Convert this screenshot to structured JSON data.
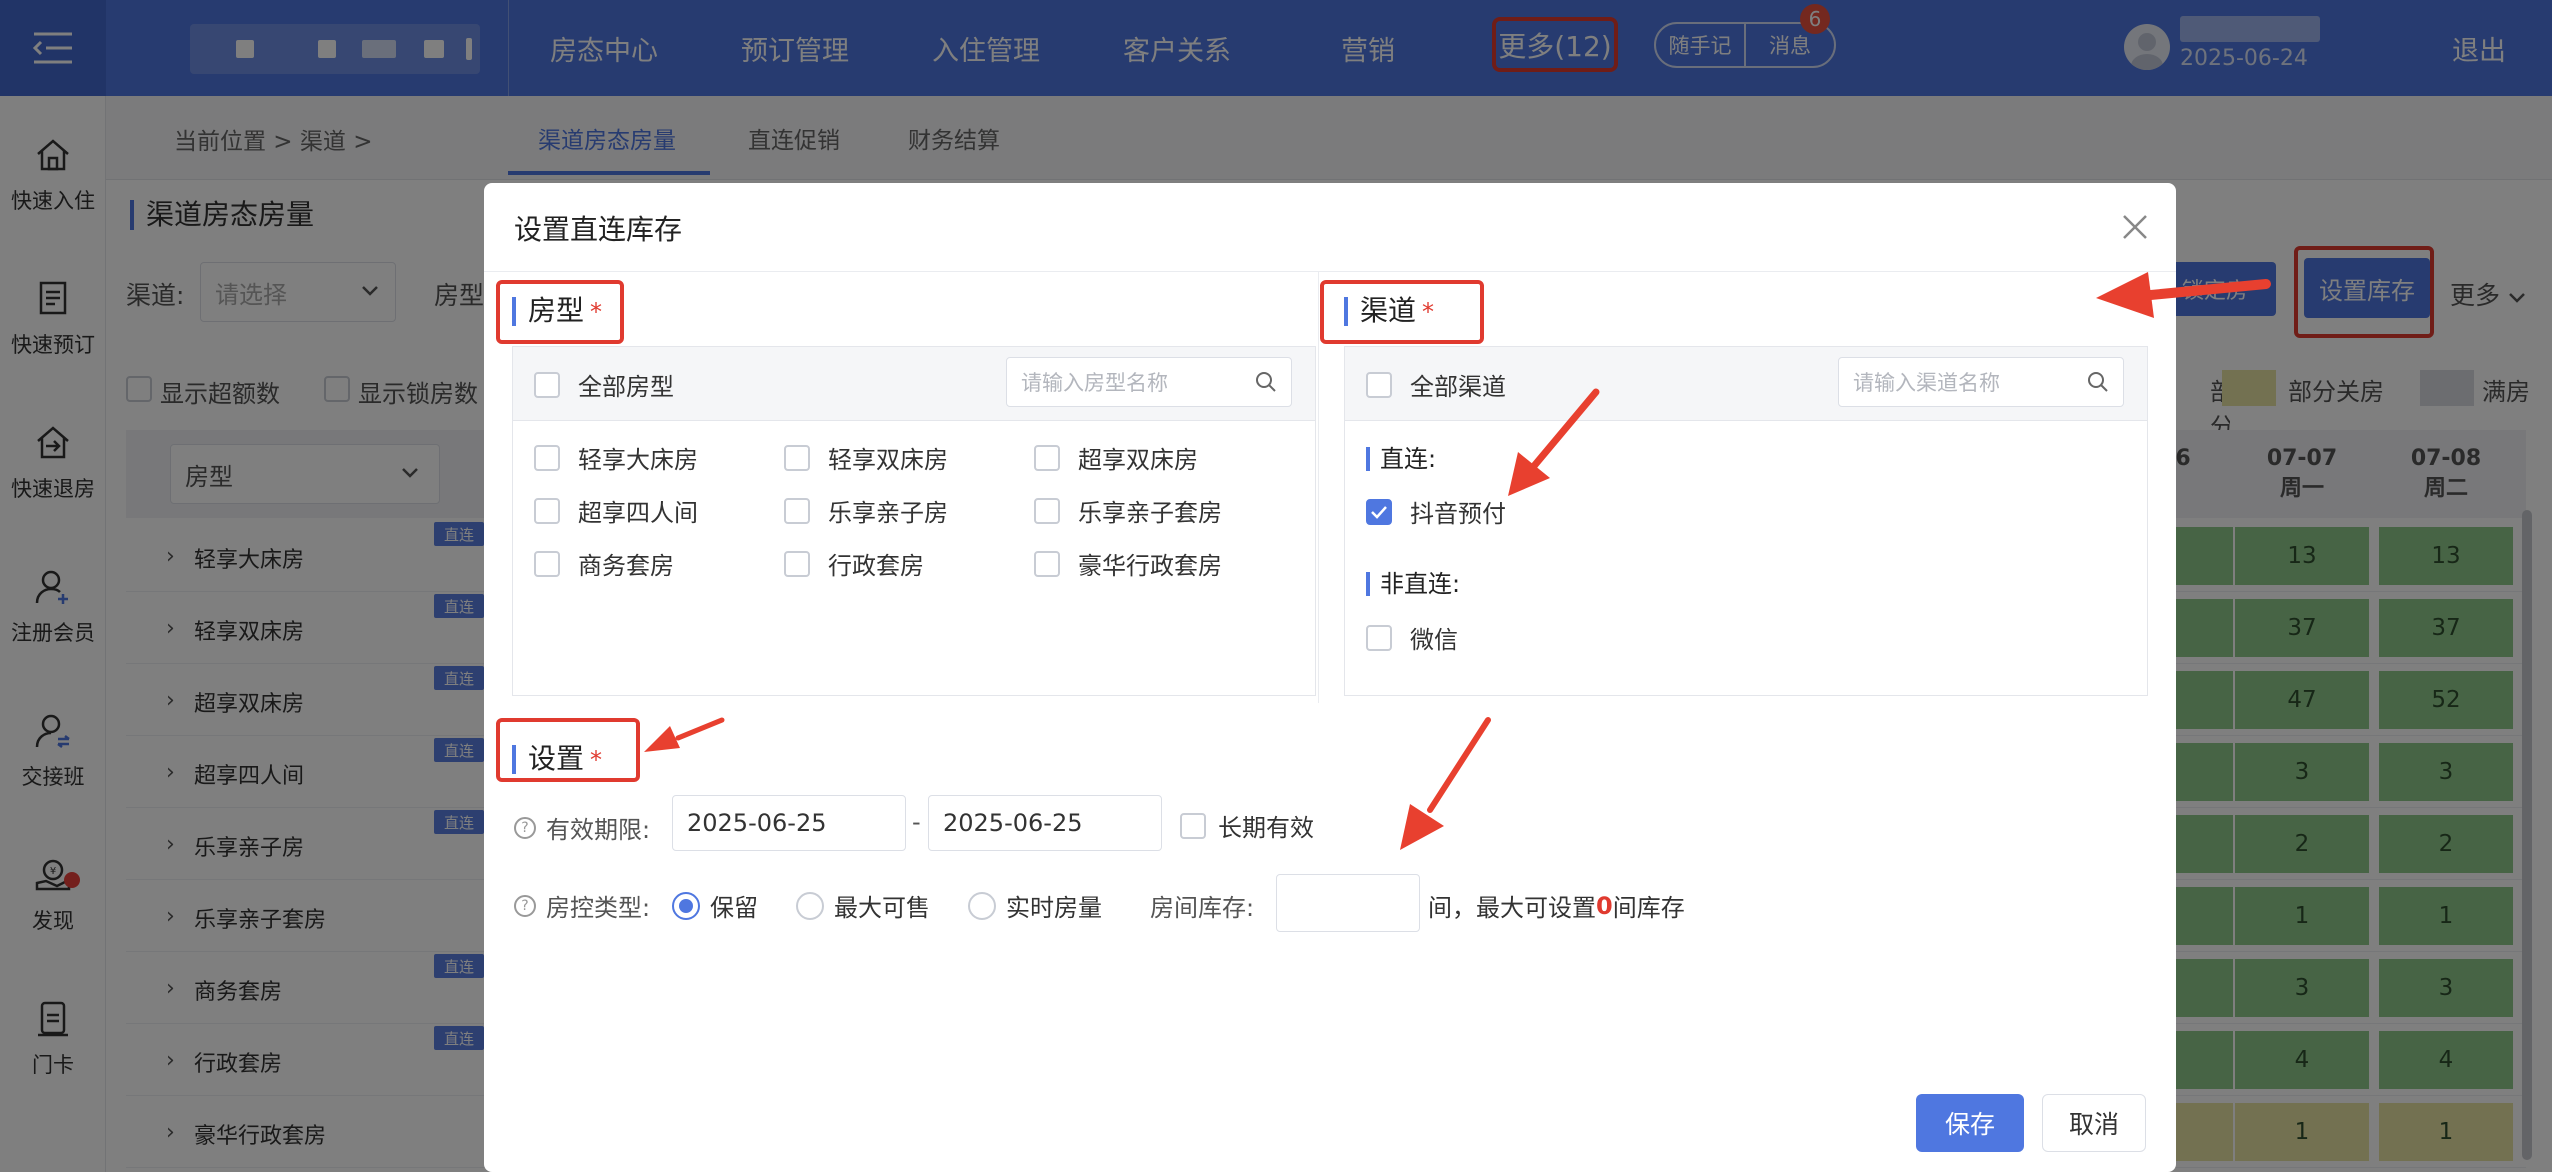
{
  "nav": {
    "items": [
      "房态中心",
      "预订管理",
      "入住管理",
      "客户关系",
      "营销"
    ],
    "more": "更多(12)",
    "notebook": "随手记",
    "messages": "消息",
    "messages_badge": "6",
    "user_date": "2025-06-24",
    "logout": "退出"
  },
  "rail": [
    {
      "label": "快速入住",
      "icon": "home-icon"
    },
    {
      "label": "快速预订",
      "icon": "document-icon"
    },
    {
      "label": "快速退房",
      "icon": "checkout-icon"
    },
    {
      "label": "注册会员",
      "icon": "add-user-icon"
    },
    {
      "label": "交接班",
      "icon": "handover-icon"
    },
    {
      "label": "发现",
      "icon": "discover-icon"
    },
    {
      "label": "门卡",
      "icon": "card-icon"
    }
  ],
  "subbar": {
    "breadcrumb": "当前位置 > 渠道 >",
    "tabs": [
      "渠道房态房量",
      "直连促销",
      "财务结算"
    ]
  },
  "page": {
    "title": "渠道房态房量",
    "channel_label": "渠道:",
    "channel_placeholder": "请选择",
    "roomtype_label": "房型",
    "show_over": "显示超额数",
    "show_lock": "显示锁房数",
    "btn_lock": "锁定房",
    "btn_set_stock": "设置库存",
    "more": "更多",
    "legend_partial": "部分关房",
    "legend_full": "满房",
    "roomtype_header": "房型",
    "col_partial": "6",
    "dates": [
      {
        "date": "07-07",
        "weekday": "周一"
      },
      {
        "date": "07-08",
        "weekday": "周二"
      }
    ],
    "direct_tag": "直连",
    "rows": [
      {
        "name": "轻享大床房",
        "direct": true,
        "v1": "13",
        "v2": "13",
        "yellow": false
      },
      {
        "name": "轻享双床房",
        "direct": true,
        "v1": "37",
        "v2": "37",
        "yellow": false
      },
      {
        "name": "超享双床房",
        "direct": true,
        "v1": "47",
        "v2": "52",
        "yellow": false
      },
      {
        "name": "超享四人间",
        "direct": true,
        "v1": "3",
        "v2": "3",
        "yellow": false
      },
      {
        "name": "乐享亲子房",
        "direct": true,
        "v1": "2",
        "v2": "2",
        "yellow": false
      },
      {
        "name": "乐享亲子套房",
        "direct": false,
        "v1": "1",
        "v2": "1",
        "yellow": false
      },
      {
        "name": "商务套房",
        "direct": true,
        "v1": "3",
        "v2": "3",
        "yellow": false
      },
      {
        "name": "行政套房",
        "direct": true,
        "v1": "4",
        "v2": "4",
        "yellow": false
      },
      {
        "name": "豪华行政套房",
        "direct": false,
        "v1": "1",
        "v2": "1",
        "yellow": true
      }
    ]
  },
  "modal": {
    "title": "设置直连库存",
    "roomtype_section": "房型",
    "required_mark": "*",
    "all_roomtypes": "全部房型",
    "roomtype_search_placeholder": "请输入房型名称",
    "roomtypes": [
      "轻享大床房",
      "轻享双床房",
      "超享双床房",
      "超享四人间",
      "乐享亲子房",
      "乐享亲子套房",
      "商务套房",
      "行政套房",
      "豪华行政套房"
    ],
    "channel_section": "渠道",
    "all_channels": "全部渠道",
    "channel_search_placeholder": "请输入渠道名称",
    "direct_group": "直连:",
    "direct_channel": "抖音预付",
    "direct_checked": true,
    "nondirect_group": "非直连:",
    "nondirect_channel": "微信",
    "settings_section": "设置",
    "validity_label": "有效期限:",
    "date_from": "2025-06-25",
    "date_sep": "-",
    "date_to": "2025-06-25",
    "long_term": "长期有效",
    "control_label": "房控类型:",
    "control_options": [
      "保留",
      "最大可售",
      "实时房量"
    ],
    "control_selected": "保留",
    "stock_label": "房间库存:",
    "stock_value": "",
    "stock_hint_pre": "间，最大可设置",
    "stock_hint_num": "0",
    "stock_hint_post": "间库存",
    "save": "保存",
    "cancel": "取消"
  },
  "colors": {
    "primary": "#4f77e0",
    "annotation_red": "#e03a2f",
    "available_green": "#8fc88b",
    "partial_yellow": "#e6e3a3",
    "full_gray": "#d9dbe0"
  }
}
